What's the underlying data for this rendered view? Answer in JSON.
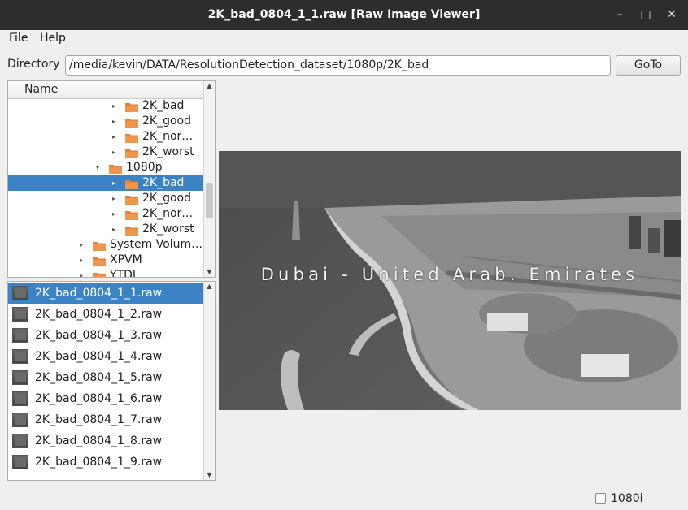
{
  "window": {
    "title": "2K_bad_0804_1_1.raw [Raw Image Viewer]",
    "minimize": "–",
    "maximize": "□",
    "close": "✕"
  },
  "menu": {
    "file": "File",
    "help": "Help"
  },
  "directory": {
    "label": "Directory",
    "value": "/media/kevin/DATA/ResolutionDetection_dataset/1080p/2K_bad",
    "goto_label": "GoTo"
  },
  "tree": {
    "header": "Name",
    "items": [
      {
        "label": "2K_bad",
        "arrow": "▸",
        "selected": false
      },
      {
        "label": "2K_good",
        "arrow": "▸",
        "selected": false
      },
      {
        "label": "2K_nor…",
        "arrow": "▸",
        "selected": false
      },
      {
        "label": "2K_worst",
        "arrow": "▸",
        "selected": false
      },
      {
        "label": "1080p",
        "arrow": "▾",
        "selected": false
      },
      {
        "label": "2K_bad",
        "arrow": "▸",
        "selected": true
      },
      {
        "label": "2K_good",
        "arrow": "▸",
        "selected": false
      },
      {
        "label": "2K_nor…",
        "arrow": "▸",
        "selected": false
      },
      {
        "label": "2K_worst",
        "arrow": "▸",
        "selected": false
      },
      {
        "label": "System Volum…",
        "arrow": "▸",
        "selected": false
      },
      {
        "label": "XPVM",
        "arrow": "▸",
        "selected": false
      },
      {
        "label": "YTDL",
        "arrow": "▸",
        "selected": false
      }
    ]
  },
  "files": {
    "items": [
      {
        "label": "2K_bad_0804_1_1.raw",
        "selected": true
      },
      {
        "label": "2K_bad_0804_1_2.raw",
        "selected": false
      },
      {
        "label": "2K_bad_0804_1_3.raw",
        "selected": false
      },
      {
        "label": "2K_bad_0804_1_4.raw",
        "selected": false
      },
      {
        "label": "2K_bad_0804_1_5.raw",
        "selected": false
      },
      {
        "label": "2K_bad_0804_1_6.raw",
        "selected": false
      },
      {
        "label": "2K_bad_0804_1_7.raw",
        "selected": false
      },
      {
        "label": "2K_bad_0804_1_8.raw",
        "selected": false
      },
      {
        "label": "2K_bad_0804_1_9.raw",
        "selected": false
      }
    ]
  },
  "viewer": {
    "overlay_text": "Dubai - United Arab. Emirates"
  },
  "interlace": {
    "label": "1080i",
    "checked": false
  },
  "colors": {
    "selection": "#3b83c5",
    "folder": "#e8823a",
    "titlebar": "#2d2d2d"
  }
}
